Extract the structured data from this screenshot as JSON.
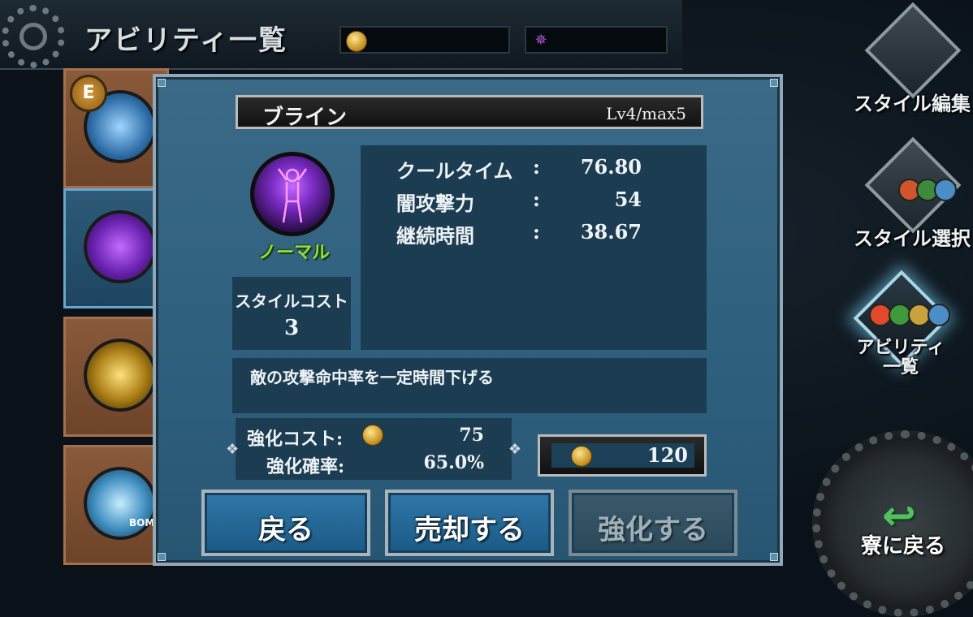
{
  "header": {
    "title": "アビリティ一覧"
  },
  "side_nav": {
    "items": [
      {
        "label": "スタイル編集",
        "icon": "style-edit-icon"
      },
      {
        "label": "スタイル選択",
        "icon": "style-select-icon"
      },
      {
        "label_line1": "アビリティ",
        "label_line2": "一覧",
        "icon": "ability-list-icon",
        "active": true
      }
    ],
    "return_label": "寮に戻る"
  },
  "ability_list": {
    "items": [
      {
        "icon": "ability-figure-blue-icon",
        "badge": "E"
      },
      {
        "icon": "ability-figure-purple-icon",
        "selected": true
      },
      {
        "icon": "ability-figure-gold-icon"
      },
      {
        "icon": "ability-splash-icon",
        "label": "BOM"
      }
    ]
  },
  "dialog": {
    "name": "ブライン",
    "level": "Lv4/max5",
    "rarity": "ノーマル",
    "style_cost_label": "スタイルコスト",
    "style_cost_value": "3",
    "stats": [
      {
        "name": "クールタイム",
        "sep": ":",
        "value": "76.80"
      },
      {
        "name": "闇攻撃力",
        "sep": ":",
        "value": "54"
      },
      {
        "name": "継続時間",
        "sep": ":",
        "value": "38.67"
      }
    ],
    "description": "敵の攻撃命中率を一定時間下げる",
    "upgrade_cost_label": "強化コスト:",
    "upgrade_cost_value": "75",
    "upgrade_rate_label": "強化確率:",
    "upgrade_rate_value": "65.0%",
    "gold_owned": "120",
    "buttons": {
      "back": "戻る",
      "sell": "売却する",
      "upgrade": "強化する"
    }
  },
  "colors": {
    "dialog_bg": "#2e5f7e",
    "panel_bg": "#1c3c52",
    "rarity_green": "#8fde4a",
    "button_blue": "#1b5a86"
  }
}
